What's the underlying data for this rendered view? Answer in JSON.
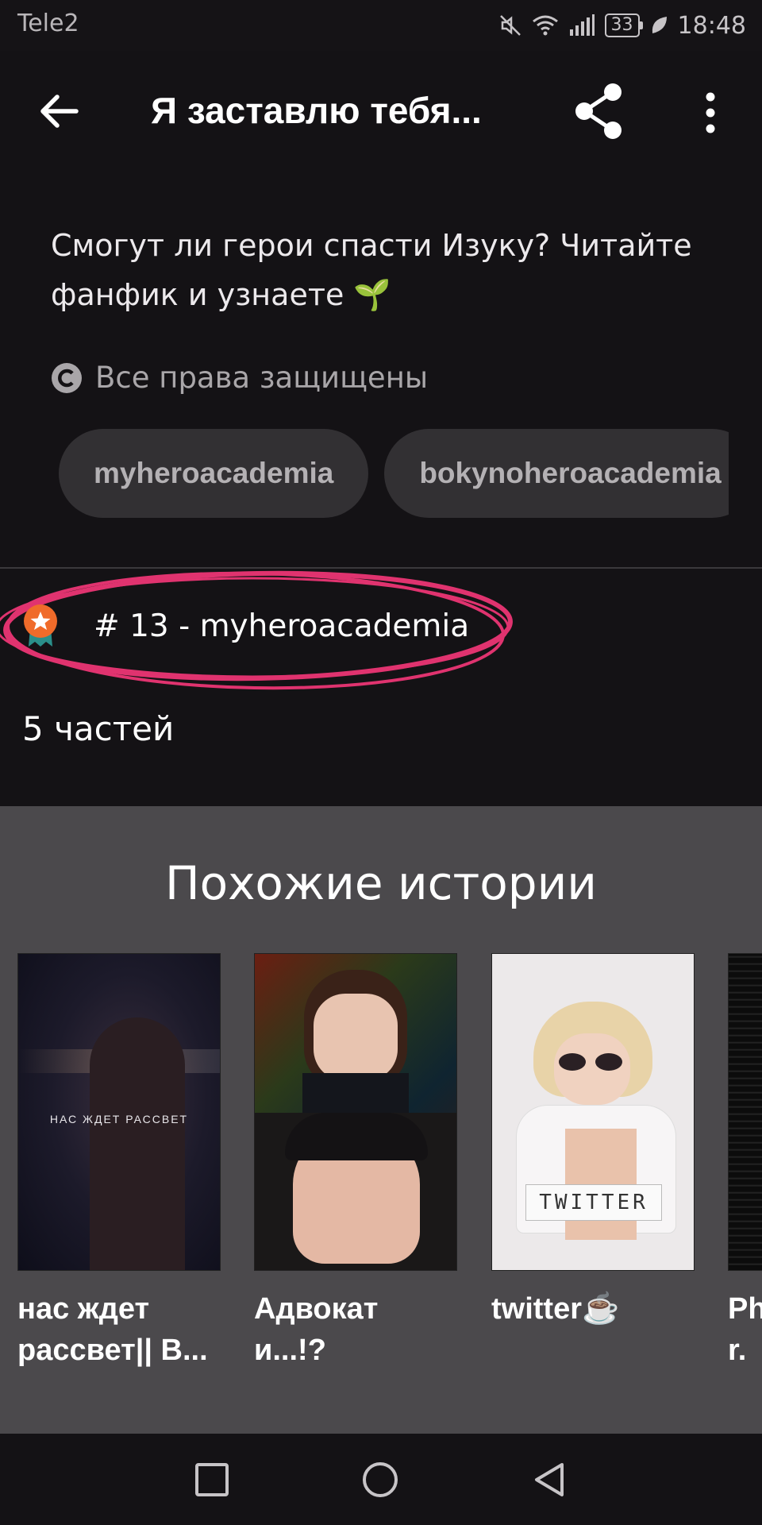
{
  "status_bar": {
    "carrier": "Tele2",
    "battery": "33",
    "time": "18:48",
    "icons": [
      "mute-icon",
      "wifi-icon",
      "signal-icon",
      "battery-icon",
      "leaf-icon"
    ]
  },
  "app_bar": {
    "title": "Я заставлю тебя...",
    "back_icon": "arrow-left-icon",
    "share_icon": "share-icon",
    "more_icon": "more-vert-icon"
  },
  "story": {
    "description_line1": "Смогут ли герои спасти Изуку? Читайте",
    "description_line2": "фанфик и узнаете 🌱",
    "copyright": "Все права защищены",
    "tags": [
      "myheroacademia",
      "bokynoheroacademia"
    ],
    "rank": "# 13 - myheroacademia",
    "parts": "5 частей"
  },
  "similar": {
    "title": "Похожие истории",
    "cards": [
      {
        "title_line1": "нас ждет",
        "title_line2": "рассвет|| B...",
        "cover_caption": "НАС ЖДЕТ РАССВЕТ"
      },
      {
        "title_line1": "Адвокат",
        "title_line2": "и...!?",
        "cover_caption": ""
      },
      {
        "title_line1": "twitter☕",
        "title_line2": "",
        "cover_caption": "TWITTER"
      },
      {
        "title_line1": "Ph",
        "title_line2": "r.",
        "cover_caption": ""
      }
    ]
  },
  "colors": {
    "background": "#141215",
    "tag_bg": "#323033",
    "similar_bg": "#4b494c",
    "highlight_circle": "#e0336f",
    "badge": "#f06b2a"
  }
}
